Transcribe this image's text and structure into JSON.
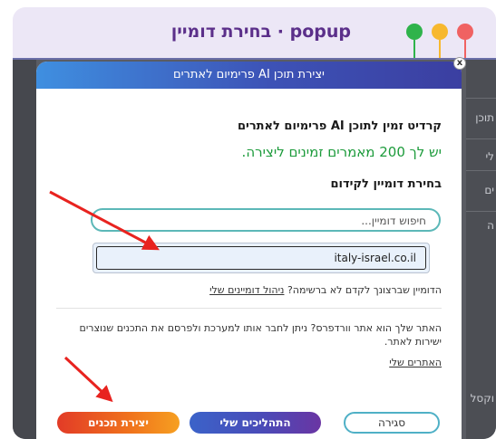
{
  "window": {
    "title": "popup · בחירת דומיין"
  },
  "modal": {
    "header_title": "יצירת תוכן AI פרימיום לאתרים",
    "credit_heading": "קרדיט זמין לתוכן AI פרימיום לאתרים",
    "remaining_text": "יש לך 200 מאמרים זמינים ליצירה.",
    "choose_domain_label": "בחירת דומיין לקידום",
    "search_placeholder": "חיפוש דומיין...",
    "selected_domain": "italy-israel.co.il",
    "missing_domain_text": "הדומיין שברצונך לקדם לא ברשימה?",
    "manage_domains_link": "ניהול דומיינים שלי",
    "wordpress_line1": "האתר שלך הוא אתר וורדפרס? ניתן לחבר אותו למערכת ולפרסם את התכנים שנוצרים",
    "wordpress_line2": "ישירות לאתר.",
    "sites_link": "האתרים שלי",
    "close_button": "סגירה",
    "processes_button": "התהליכים שלי",
    "create_button": "יצירת תכנים",
    "close_x": "x"
  },
  "background": {
    "fragments": [
      "תוכן",
      "לי",
      "ים",
      "ה",
      "וקסל"
    ]
  },
  "colors": {
    "accent_green": "#1c9b3b",
    "title_purple": "#5b2f8a",
    "arrow_red": "#e8231f"
  }
}
